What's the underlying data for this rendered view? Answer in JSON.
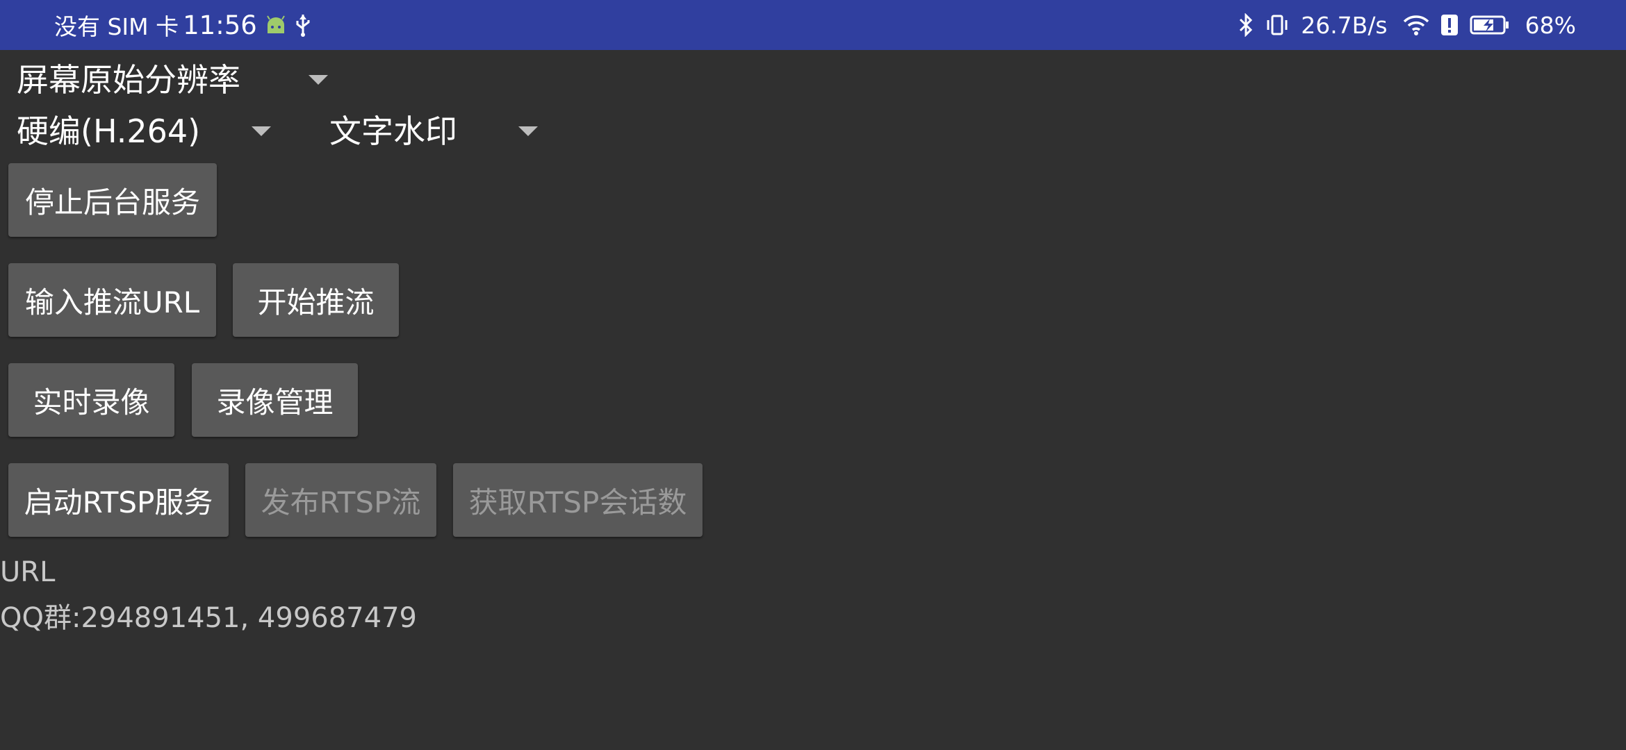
{
  "status_bar": {
    "carrier": "没有 SIM 卡",
    "time": "11:56",
    "left_icons": [
      "android-icon",
      "usb-icon"
    ],
    "right_icons": [
      "bluetooth-icon",
      "vibrate-icon"
    ],
    "net_speed": "26.7B/s",
    "signal_icons": [
      "wifi-icon",
      "alert-icon",
      "battery-charging-icon"
    ],
    "battery": "68%",
    "background_color": "#303f9f"
  },
  "spinners": {
    "resolution": "屏幕原始分辨率",
    "encoder": "硬编(H.264)",
    "watermark": "文字水印"
  },
  "buttons": {
    "stop_service": "停止后台服务",
    "input_url": "输入推流URL",
    "start_push": "开始推流",
    "realtime_record": "实时录像",
    "record_manage": "录像管理",
    "start_rtsp": "启动RTSP服务",
    "publish_rtsp": "发布RTSP流",
    "get_rtsp_sessions": "获取RTSP会话数"
  },
  "info": {
    "url_label": "URL",
    "qq_group": "QQ群:294891451, 499687479"
  },
  "colors": {
    "background": "#303030",
    "button": "#595959",
    "disabled_text": "#9a9a9a"
  }
}
